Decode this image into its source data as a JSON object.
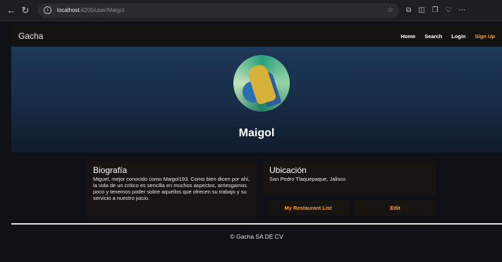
{
  "browser": {
    "host": "localhost",
    "path": ":4200/user/Maigol"
  },
  "navbar": {
    "brand": "Gacha",
    "links": {
      "home": "Home",
      "search": "Search",
      "login": "Login",
      "signup": "Sign Up"
    }
  },
  "profile": {
    "username": "Maigol",
    "bio_title": "Biografía",
    "bio_text": "Miguel, mejor conocido como Maigol193. Como bien dicen por ahí, la vida de un crítico es sencilla en muchos aspectos, arriesgamos poco y tenemos poder sobre aquellos que ofrecen su trabajo y su servicio a nuestro juicio.",
    "location_title": "Ubicación",
    "location_text": "San Pedro Tlaquepaque, Jalisco"
  },
  "actions": {
    "restaurant_list": "My Restaurant List",
    "edit": "Edit"
  },
  "footer": {
    "text": "© Gacha SA DE CV"
  },
  "colors": {
    "accent": "#f0a23c",
    "navbar_bg": "#141311",
    "hero_top": "#1e3858",
    "page_bg": "#0f1117"
  }
}
